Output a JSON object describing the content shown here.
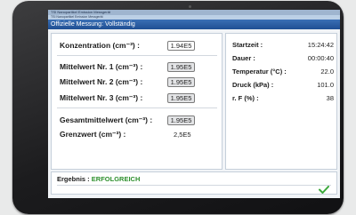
{
  "window": {
    "title": "TSI Nanopartikel Emission Messgerät",
    "subtitle": "TSI Nanopartikel Emission Messgerät",
    "header": "Offizielle Messung: Vollständig"
  },
  "measurements": {
    "concentration": {
      "label": "Konzentration (cm⁻³) :",
      "value": "1.94E5"
    },
    "mean1": {
      "label": "Mittelwert Nr. 1 (cm⁻³) :",
      "value": "1.95E5"
    },
    "mean2": {
      "label": "Mittelwert Nr. 2 (cm⁻³) :",
      "value": "1.95E5"
    },
    "mean3": {
      "label": "Mittelwert Nr. 3 (cm⁻³) :",
      "value": "1.95E5"
    },
    "total_mean": {
      "label": "Gesamtmittelwert (cm⁻³) :",
      "value": "1.95E5"
    },
    "limit": {
      "label": "Grenzwert (cm⁻³) :",
      "value": "2,5E5"
    }
  },
  "conditions": {
    "start_time": {
      "label": "Startzeit :",
      "value": "15:24:42"
    },
    "duration": {
      "label": "Dauer :",
      "value": "00:00:40"
    },
    "temperature": {
      "label": "Temperatur (°C) :",
      "value": "22.0"
    },
    "pressure": {
      "label": "Druck (kPa) :",
      "value": "101.0"
    },
    "humidity": {
      "label": "r. F (%) :",
      "value": "38"
    }
  },
  "result": {
    "label": "Ergebnis :",
    "value": "ERFOLGREICH"
  },
  "colors": {
    "header": "#1f4f93",
    "success": "#2d8f2d",
    "confirm_check": "#3aa83a"
  },
  "icons": {
    "confirm": "checkmark-icon"
  }
}
